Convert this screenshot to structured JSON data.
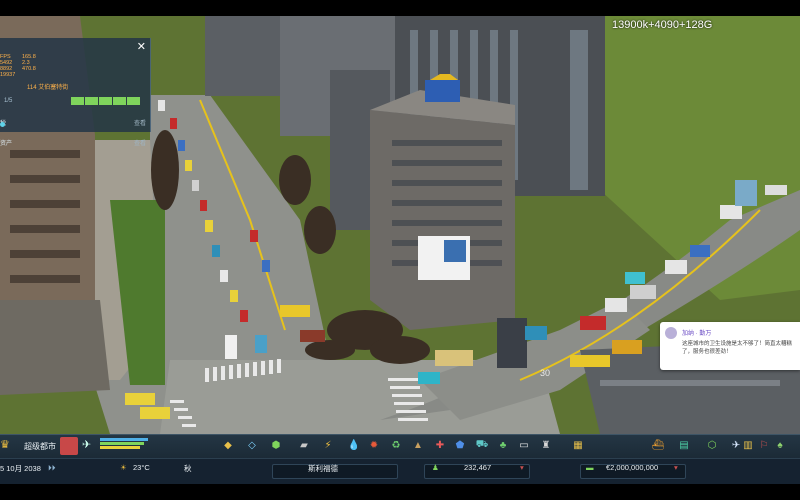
{
  "perf_overlay": "13900k+4090+128G",
  "info_panel": {
    "close_label": "✕",
    "header": "114 艾伯塞特街",
    "fps_stats": [
      "FPS",
      "5492",
      "8892",
      "19937"
    ],
    "fps_values": [
      "",
      "165.8",
      "2.3",
      "470.8"
    ],
    "progress_label": "1/5",
    "progress_segments": 5,
    "rows": [
      {
        "label": "税",
        "value": ""
      },
      {
        "label": "资产",
        "value": ""
      }
    ],
    "row_values": [
      "查看",
      "查看"
    ]
  },
  "chirp": {
    "name": "加纳 · 勤万",
    "message": "这座城市的卫生设施是太不够了！简直太糟糕了，服务也很差劲！"
  },
  "toolbar": {
    "city_name": "超级都市",
    "tool_icons": [
      "road-icon",
      "zoning-icon",
      "area-icon",
      "water-icon",
      "electricity-icon",
      "water-drop-icon",
      "fire-icon",
      "recycle-icon",
      "education-icon",
      "health-icon",
      "police-icon",
      "transport-icon",
      "park-icon",
      "chat-icon",
      "landmark-icon",
      "map-icon",
      "ship-icon",
      "money-icon",
      "expand-icon",
      "plane-icon",
      "chart-icon",
      "sign-icon",
      "tree-icon"
    ]
  },
  "status_bar": {
    "date": "5 10月 2038",
    "temperature": "23°C",
    "season": "秋",
    "district": "斯利福德",
    "population": "232,467",
    "money": "€2,000,000,000"
  }
}
